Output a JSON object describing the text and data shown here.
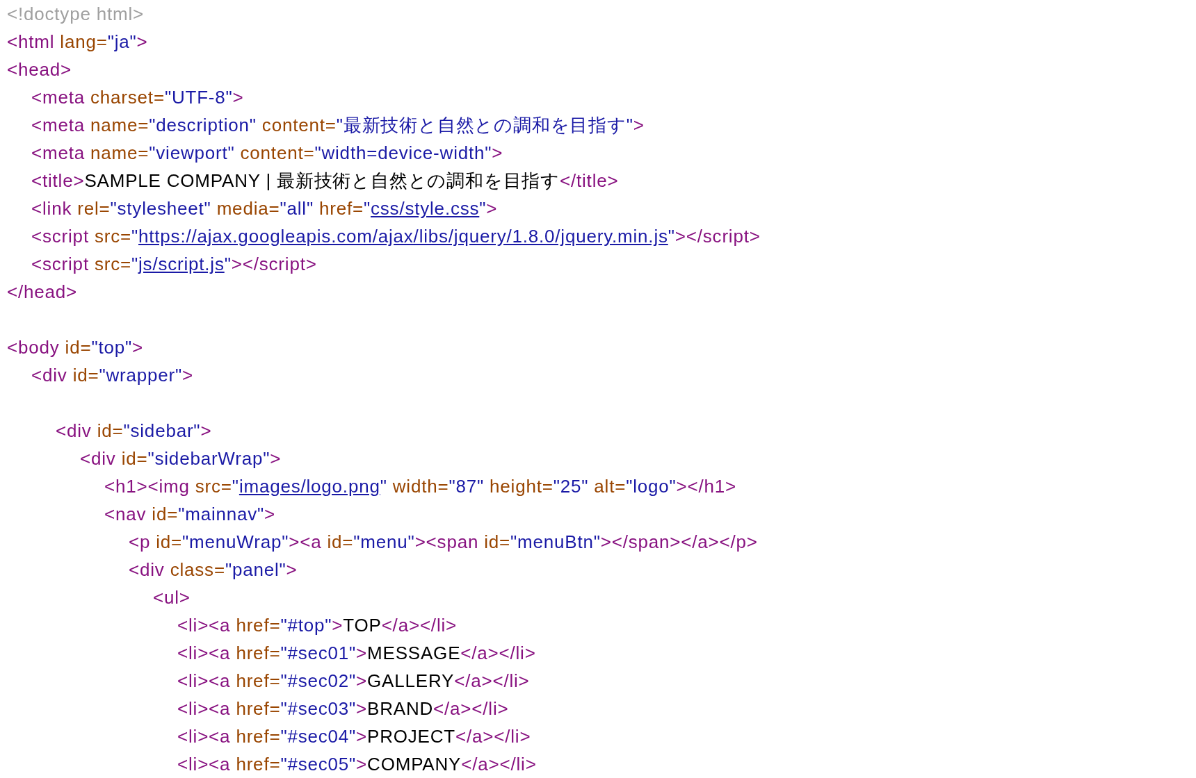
{
  "source_lines": [
    {
      "kind": "code",
      "tokens": [
        {
          "kind": "doctype",
          "text": "<!doctype html>"
        }
      ]
    },
    {
      "kind": "code",
      "tokens": [
        {
          "kind": "tag",
          "text": "<html"
        },
        {
          "kind": "attr",
          "text": " lang="
        },
        {
          "kind": "value",
          "text": "\"ja\""
        },
        {
          "kind": "tag",
          "text": ">"
        }
      ]
    },
    {
      "kind": "code",
      "tokens": [
        {
          "kind": "tag",
          "text": "<head>"
        }
      ],
      "children": [
        {
          "kind": "code",
          "tokens": [
            {
              "kind": "tag",
              "text": "<meta"
            },
            {
              "kind": "attr",
              "text": " charset="
            },
            {
              "kind": "value",
              "text": "\"UTF-8\""
            },
            {
              "kind": "tag",
              "text": ">"
            }
          ]
        },
        {
          "kind": "code",
          "tokens": [
            {
              "kind": "tag",
              "text": "<meta"
            },
            {
              "kind": "attr",
              "text": " name="
            },
            {
              "kind": "value",
              "text": "\"description\""
            },
            {
              "kind": "attr",
              "text": " content="
            },
            {
              "kind": "value",
              "text": "\"最新技術と自然との調和を目指す\""
            },
            {
              "kind": "tag",
              "text": ">"
            }
          ]
        },
        {
          "kind": "code",
          "tokens": [
            {
              "kind": "tag",
              "text": "<meta"
            },
            {
              "kind": "attr",
              "text": " name="
            },
            {
              "kind": "value",
              "text": "\"viewport\""
            },
            {
              "kind": "attr",
              "text": " content="
            },
            {
              "kind": "value",
              "text": "\"width=device-width\""
            },
            {
              "kind": "tag",
              "text": ">"
            }
          ]
        },
        {
          "kind": "code",
          "tokens": [
            {
              "kind": "tag",
              "text": "<title>"
            },
            {
              "kind": "text",
              "text": "SAMPLE COMPANY | 最新技術と自然との調和を目指す"
            },
            {
              "kind": "tag",
              "text": "</title>"
            }
          ]
        },
        {
          "kind": "code",
          "tokens": [
            {
              "kind": "tag",
              "text": "<link"
            },
            {
              "kind": "attr",
              "text": " rel="
            },
            {
              "kind": "value",
              "text": "\"stylesheet\""
            },
            {
              "kind": "attr",
              "text": " media="
            },
            {
              "kind": "value",
              "text": "\"all\""
            },
            {
              "kind": "attr",
              "text": " href="
            },
            {
              "kind": "value",
              "text": "\""
            },
            {
              "kind": "link",
              "text": "css/style.css"
            },
            {
              "kind": "value",
              "text": "\""
            },
            {
              "kind": "tag",
              "text": ">"
            }
          ]
        },
        {
          "kind": "code",
          "tokens": [
            {
              "kind": "tag",
              "text": "<script"
            },
            {
              "kind": "attr",
              "text": " src="
            },
            {
              "kind": "value",
              "text": "\""
            },
            {
              "kind": "link",
              "text": "https://ajax.googleapis.com/ajax/libs/jquery/1.8.0/jquery.min.js"
            },
            {
              "kind": "value",
              "text": "\""
            },
            {
              "kind": "tag",
              "text": "></script>"
            }
          ]
        },
        {
          "kind": "code",
          "tokens": [
            {
              "kind": "tag",
              "text": "<script"
            },
            {
              "kind": "attr",
              "text": " src="
            },
            {
              "kind": "value",
              "text": "\""
            },
            {
              "kind": "link",
              "text": "js/script.js"
            },
            {
              "kind": "value",
              "text": "\""
            },
            {
              "kind": "tag",
              "text": "></script>"
            }
          ]
        }
      ]
    },
    {
      "kind": "code",
      "tokens": [
        {
          "kind": "tag",
          "text": "</head>"
        }
      ]
    },
    {
      "kind": "blank"
    },
    {
      "kind": "code",
      "tokens": [
        {
          "kind": "tag",
          "text": "<body"
        },
        {
          "kind": "attr",
          "text": " id="
        },
        {
          "kind": "value",
          "text": "\"top\""
        },
        {
          "kind": "tag",
          "text": ">"
        }
      ],
      "children": [
        {
          "kind": "code",
          "tokens": [
            {
              "kind": "tag",
              "text": "<div"
            },
            {
              "kind": "attr",
              "text": " id="
            },
            {
              "kind": "value",
              "text": "\"wrapper\""
            },
            {
              "kind": "tag",
              "text": ">"
            }
          ],
          "children": [
            {
              "kind": "blank"
            },
            {
              "kind": "code",
              "tokens": [
                {
                  "kind": "tag",
                  "text": "<div"
                },
                {
                  "kind": "attr",
                  "text": " id="
                },
                {
                  "kind": "value",
                  "text": "\"sidebar\""
                },
                {
                  "kind": "tag",
                  "text": ">"
                }
              ],
              "children": [
                {
                  "kind": "code",
                  "tokens": [
                    {
                      "kind": "tag",
                      "text": "<div"
                    },
                    {
                      "kind": "attr",
                      "text": " id="
                    },
                    {
                      "kind": "value",
                      "text": "\"sidebarWrap\""
                    },
                    {
                      "kind": "tag",
                      "text": ">"
                    }
                  ],
                  "children": [
                    {
                      "kind": "code",
                      "tokens": [
                        {
                          "kind": "tag",
                          "text": "<h1><img"
                        },
                        {
                          "kind": "attr",
                          "text": " src="
                        },
                        {
                          "kind": "value",
                          "text": "\""
                        },
                        {
                          "kind": "link",
                          "text": "images/logo.png"
                        },
                        {
                          "kind": "value",
                          "text": "\""
                        },
                        {
                          "kind": "attr",
                          "text": " width="
                        },
                        {
                          "kind": "value",
                          "text": "\"87\""
                        },
                        {
                          "kind": "attr",
                          "text": " height="
                        },
                        {
                          "kind": "value",
                          "text": "\"25\""
                        },
                        {
                          "kind": "attr",
                          "text": " alt="
                        },
                        {
                          "kind": "value",
                          "text": "\"logo\""
                        },
                        {
                          "kind": "tag",
                          "text": "></h1>"
                        }
                      ]
                    },
                    {
                      "kind": "code",
                      "tokens": [
                        {
                          "kind": "tag",
                          "text": "<nav"
                        },
                        {
                          "kind": "attr",
                          "text": " id="
                        },
                        {
                          "kind": "value",
                          "text": "\"mainnav\""
                        },
                        {
                          "kind": "tag",
                          "text": ">"
                        }
                      ],
                      "children": [
                        {
                          "kind": "code",
                          "tokens": [
                            {
                              "kind": "tag",
                              "text": "<p"
                            },
                            {
                              "kind": "attr",
                              "text": " id="
                            },
                            {
                              "kind": "value",
                              "text": "\"menuWrap\""
                            },
                            {
                              "kind": "tag",
                              "text": "><a"
                            },
                            {
                              "kind": "attr",
                              "text": " id="
                            },
                            {
                              "kind": "value",
                              "text": "\"menu\""
                            },
                            {
                              "kind": "tag",
                              "text": "><span"
                            },
                            {
                              "kind": "attr",
                              "text": " id="
                            },
                            {
                              "kind": "value",
                              "text": "\"menuBtn\""
                            },
                            {
                              "kind": "tag",
                              "text": "></span></a></p>"
                            }
                          ]
                        },
                        {
                          "kind": "code",
                          "tokens": [
                            {
                              "kind": "tag",
                              "text": "<div"
                            },
                            {
                              "kind": "attr",
                              "text": " class="
                            },
                            {
                              "kind": "value",
                              "text": "\"panel\""
                            },
                            {
                              "kind": "tag",
                              "text": ">"
                            }
                          ],
                          "children": [
                            {
                              "kind": "code",
                              "tokens": [
                                {
                                  "kind": "tag",
                                  "text": "<ul>"
                                }
                              ],
                              "children": [
                                {
                                  "kind": "code",
                                  "tokens": [
                                    {
                                      "kind": "tag",
                                      "text": "<li><a"
                                    },
                                    {
                                      "kind": "attr",
                                      "text": " href="
                                    },
                                    {
                                      "kind": "value",
                                      "text": "\"#top\""
                                    },
                                    {
                                      "kind": "tag",
                                      "text": ">"
                                    },
                                    {
                                      "kind": "text",
                                      "text": "TOP"
                                    },
                                    {
                                      "kind": "tag",
                                      "text": "</a></li>"
                                    }
                                  ]
                                },
                                {
                                  "kind": "code",
                                  "tokens": [
                                    {
                                      "kind": "tag",
                                      "text": "<li><a"
                                    },
                                    {
                                      "kind": "attr",
                                      "text": " href="
                                    },
                                    {
                                      "kind": "value",
                                      "text": "\"#sec01\""
                                    },
                                    {
                                      "kind": "tag",
                                      "text": ">"
                                    },
                                    {
                                      "kind": "text",
                                      "text": "MESSAGE"
                                    },
                                    {
                                      "kind": "tag",
                                      "text": "</a></li>"
                                    }
                                  ]
                                },
                                {
                                  "kind": "code",
                                  "tokens": [
                                    {
                                      "kind": "tag",
                                      "text": "<li><a"
                                    },
                                    {
                                      "kind": "attr",
                                      "text": " href="
                                    },
                                    {
                                      "kind": "value",
                                      "text": "\"#sec02\""
                                    },
                                    {
                                      "kind": "tag",
                                      "text": ">"
                                    },
                                    {
                                      "kind": "text",
                                      "text": "GALLERY"
                                    },
                                    {
                                      "kind": "tag",
                                      "text": "</a></li>"
                                    }
                                  ]
                                },
                                {
                                  "kind": "code",
                                  "tokens": [
                                    {
                                      "kind": "tag",
                                      "text": "<li><a"
                                    },
                                    {
                                      "kind": "attr",
                                      "text": " href="
                                    },
                                    {
                                      "kind": "value",
                                      "text": "\"#sec03\""
                                    },
                                    {
                                      "kind": "tag",
                                      "text": ">"
                                    },
                                    {
                                      "kind": "text",
                                      "text": "BRAND"
                                    },
                                    {
                                      "kind": "tag",
                                      "text": "</a></li>"
                                    }
                                  ]
                                },
                                {
                                  "kind": "code",
                                  "tokens": [
                                    {
                                      "kind": "tag",
                                      "text": "<li><a"
                                    },
                                    {
                                      "kind": "attr",
                                      "text": " href="
                                    },
                                    {
                                      "kind": "value",
                                      "text": "\"#sec04\""
                                    },
                                    {
                                      "kind": "tag",
                                      "text": ">"
                                    },
                                    {
                                      "kind": "text",
                                      "text": "PROJECT"
                                    },
                                    {
                                      "kind": "tag",
                                      "text": "</a></li>"
                                    }
                                  ]
                                },
                                {
                                  "kind": "code",
                                  "tokens": [
                                    {
                                      "kind": "tag",
                                      "text": "<li><a"
                                    },
                                    {
                                      "kind": "attr",
                                      "text": " href="
                                    },
                                    {
                                      "kind": "value",
                                      "text": "\"#sec05\""
                                    },
                                    {
                                      "kind": "tag",
                                      "text": ">"
                                    },
                                    {
                                      "kind": "text",
                                      "text": "COMPANY"
                                    },
                                    {
                                      "kind": "tag",
                                      "text": "</a></li>"
                                    }
                                  ]
                                }
                              ]
                            }
                          ]
                        }
                      ]
                    }
                  ]
                }
              ]
            }
          ]
        }
      ]
    }
  ]
}
